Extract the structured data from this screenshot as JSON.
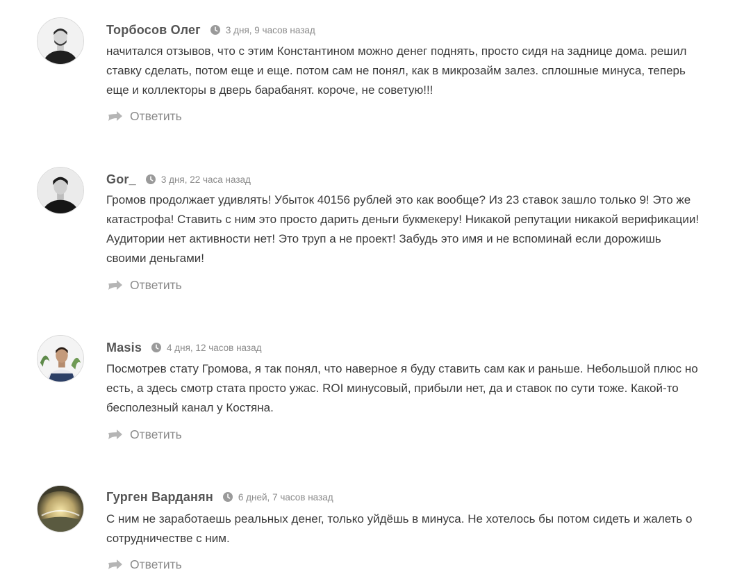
{
  "comments": [
    {
      "author": "Торбосов Олег",
      "date": "3 дня, 9 часов назад",
      "text": "начитался отзывов, что с этим Константином можно денег поднять, просто сидя на заднице дома. решил ставку сделать, потом еще и еще. потом сам не понял, как в микрозайм залез. сплошные минуса, теперь еще и коллекторы в дверь барабанят. короче, не советую!!!",
      "reply_label": "Ответить"
    },
    {
      "author": "Gor_",
      "date": "3 дня, 22 часа назад",
      "text": "Громов продолжает удивлять! Убыток 40156 рублей это как вообще? Из 23 ставок зашло только 9! Это же катастрофа! Ставить с ним это просто дарить деньги букмекеру! Никакой репутации никакой верификации! Аудитории нет активности нет! Это труп а не проект! Забудь это имя и не вспоминай если дорожишь своими деньгами!",
      "reply_label": "Ответить"
    },
    {
      "author": "Masis",
      "date": "4 дня, 12 часов назад",
      "text": "Посмотрев стату Громова, я так понял, что наверное я буду ставить сам как и раньше. Небольшой плюс но есть, а здесь смотр стата просто ужас. ROI минусовый, прибыли нет, да и ставок по сути тоже. Какой-то бесполезный канал у Костяна.",
      "reply_label": "Ответить"
    },
    {
      "author": "Гурген Варданян",
      "date": "6 дней, 7 часов назад",
      "text": "С ним не заработаешь реальных денег, только уйдёшь в минуса. Не хотелось бы потом сидеть и жалеть о сотрудничестве с ним.",
      "reply_label": "Ответить"
    }
  ],
  "icons": {
    "clock": "clock-icon",
    "reply": "reply-arrow-icon"
  },
  "colors": {
    "author": "#555555",
    "meta": "#8a8a8a",
    "text": "#3a3a3a"
  }
}
